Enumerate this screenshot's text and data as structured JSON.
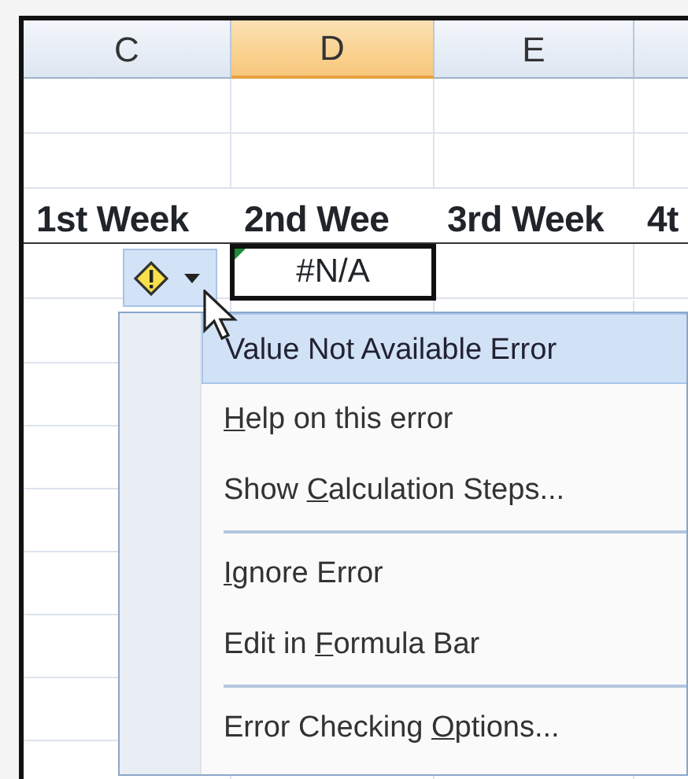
{
  "columns": [
    {
      "label": "C",
      "selected": false
    },
    {
      "label": "D",
      "selected": true
    },
    {
      "label": "E",
      "selected": false
    }
  ],
  "week_headers": [
    "1st Week",
    "2nd Wee",
    "3rd Week",
    "4t"
  ],
  "error_cell": {
    "value": "#N/A",
    "has_error": true
  },
  "error_menu": [
    {
      "kind": "title",
      "selected": true,
      "separator_before": false,
      "before": "Value Not Available Error"
    },
    {
      "kind": "item",
      "selected": false,
      "separator_before": false,
      "access_key": "H",
      "after": "elp on this error"
    },
    {
      "kind": "item",
      "selected": false,
      "separator_before": false,
      "before": "Show ",
      "access_key": "C",
      "after": "alculation Steps..."
    },
    {
      "kind": "item",
      "selected": false,
      "separator_before": true,
      "access_key": "I",
      "after": "gnore Error"
    },
    {
      "kind": "item",
      "selected": false,
      "separator_before": false,
      "before": "Edit in ",
      "access_key": "F",
      "after": "ormula Bar"
    },
    {
      "kind": "item",
      "selected": false,
      "separator_before": true,
      "before": "Error Checking ",
      "access_key": "O",
      "after": "ptions..."
    }
  ]
}
